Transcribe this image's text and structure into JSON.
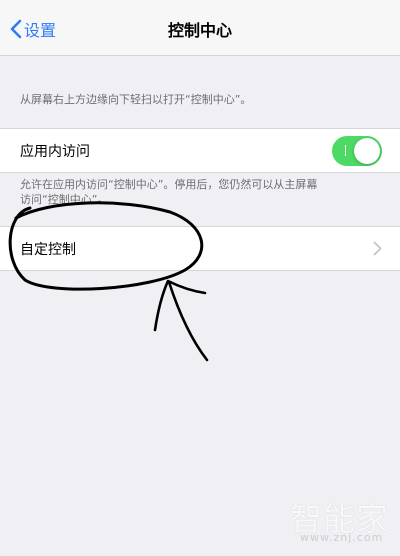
{
  "nav": {
    "back_label": "设置",
    "title": "控制中心"
  },
  "hints": {
    "top": "从屏幕右上方边缘向下轻扫以打开“控制中心”。",
    "access_line1": "允许在应用内访问“控制中心”。停用后，您仍然可以从主屏幕",
    "access_line2": "访问“控制中心”。"
  },
  "settings": {
    "in_app_access": {
      "label": "应用内访问",
      "enabled": true
    },
    "customize": {
      "label": "自定控制"
    }
  },
  "colors": {
    "accent": "#2f7cf6",
    "toggle_on": "#4cd964",
    "background": "#efeff4"
  },
  "icons": [
    "back-chevron-icon",
    "chevron-right-icon"
  ],
  "watermark": {
    "logo": "智能家",
    "url": "www.znj.com"
  }
}
